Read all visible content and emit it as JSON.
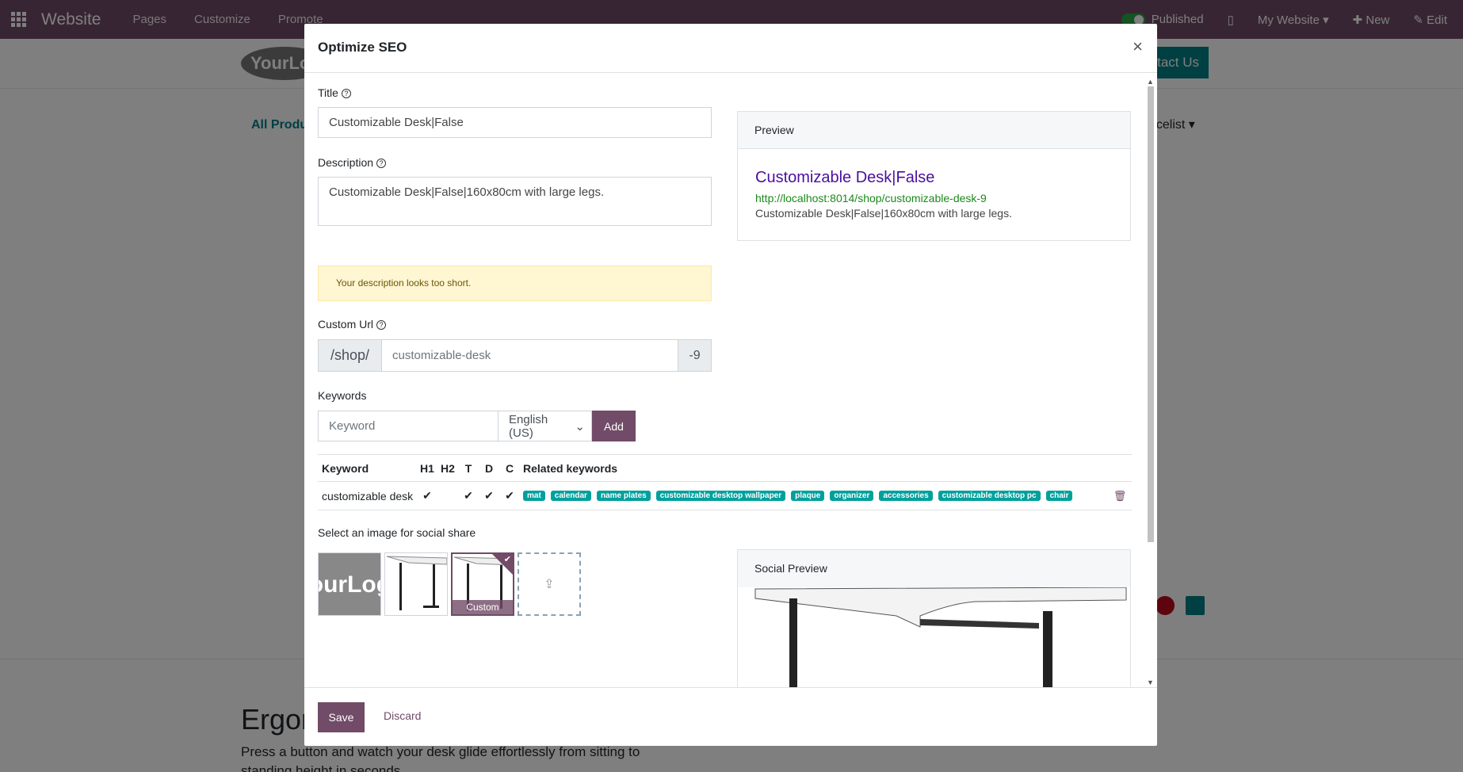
{
  "topbar": {
    "brand": "Website",
    "menu": [
      "Pages",
      "Customize",
      "Promote"
    ],
    "published": "Published",
    "my_website": "My Website",
    "new": "New",
    "edit": "Edit"
  },
  "site": {
    "logo": "YourLogo",
    "contact": "tact Us",
    "all_products": "All Produ",
    "pricelist": "ricelist",
    "heading": "Ergon",
    "body_text": "Press a button and watch your desk glide effortlessly from sitting to standing height in seconds."
  },
  "modal": {
    "title": "Optimize SEO",
    "close": "×",
    "title_label": "Title",
    "title_value": "Customizable Desk|False",
    "description_label": "Description",
    "description_value": "Customizable Desk|False|160x80cm with large legs.",
    "warning": "Your description looks too short.",
    "custom_url_label": "Custom Url",
    "url_prefix": "/shop/",
    "url_slug_placeholder": "customizable-desk",
    "url_suffix": "-9",
    "keywords_label": "Keywords",
    "keyword_placeholder": "Keyword",
    "language": "English (US)",
    "add": "Add",
    "table_headers": {
      "keyword": "Keyword",
      "h1": "H1",
      "h2": "H2",
      "t": "T",
      "d": "D",
      "c": "C",
      "related": "Related keywords"
    },
    "keyword_row": {
      "keyword": "customizable desk",
      "h1": "✔",
      "h2": "",
      "t": "✔",
      "d": "✔",
      "c": "✔",
      "related": [
        "mat",
        "calendar",
        "name plates",
        "customizable desktop wallpaper",
        "plaque",
        "organizer",
        "accessories",
        "customizable desktop pc",
        "chair"
      ]
    },
    "image_label": "Select an image for social share",
    "custom_caption": "Custom",
    "preview_label": "Preview",
    "preview_title": "Customizable Desk|False",
    "preview_url": "http://localhost:8014/shop/customizable-desk-9",
    "preview_desc": "Customizable Desk|False|160x80cm with large legs.",
    "social_preview_label": "Social Preview",
    "save": "Save",
    "discard": "Discard"
  },
  "colors": {
    "brand": "#714B67",
    "teal": "#00a09d",
    "link_title": "#4b0e9e",
    "link_url": "#1a8a1a"
  }
}
